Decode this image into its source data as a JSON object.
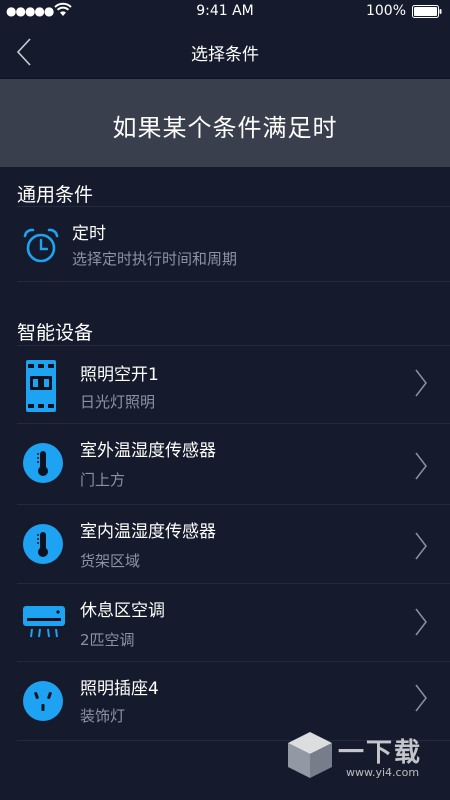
{
  "status_bar": {
    "signal": "●●●●●",
    "time": "9:41 AM",
    "battery": "100%"
  },
  "nav": {
    "title": "选择条件"
  },
  "banner": {
    "text": "如果某个条件满足时"
  },
  "sections": {
    "general": {
      "title": "通用条件",
      "items": [
        {
          "name": "定时",
          "sub": "选择定时执行时间和周期",
          "icon": "alarm-clock-icon"
        }
      ]
    },
    "devices": {
      "title": "智能设备",
      "items": [
        {
          "name": "照明空开1",
          "sub": "日光灯照明",
          "icon": "circuit-breaker-icon"
        },
        {
          "name": "室外温湿度传感器",
          "sub": "门上方",
          "icon": "thermometer-icon"
        },
        {
          "name": "室内温湿度传感器",
          "sub": "货架区域",
          "icon": "thermometer-icon"
        },
        {
          "name": "休息区空调",
          "sub": "2匹空调",
          "icon": "air-conditioner-icon"
        },
        {
          "name": "照明插座4",
          "sub": "装饰灯",
          "icon": "socket-icon"
        }
      ]
    }
  },
  "watermark": {
    "text": "一下载",
    "url": "www.yi4.com"
  },
  "colors": {
    "background": "#151b2c",
    "banner": "#3a3f4d",
    "accent": "#1ea2f2",
    "subtext": "#8b93a3"
  }
}
